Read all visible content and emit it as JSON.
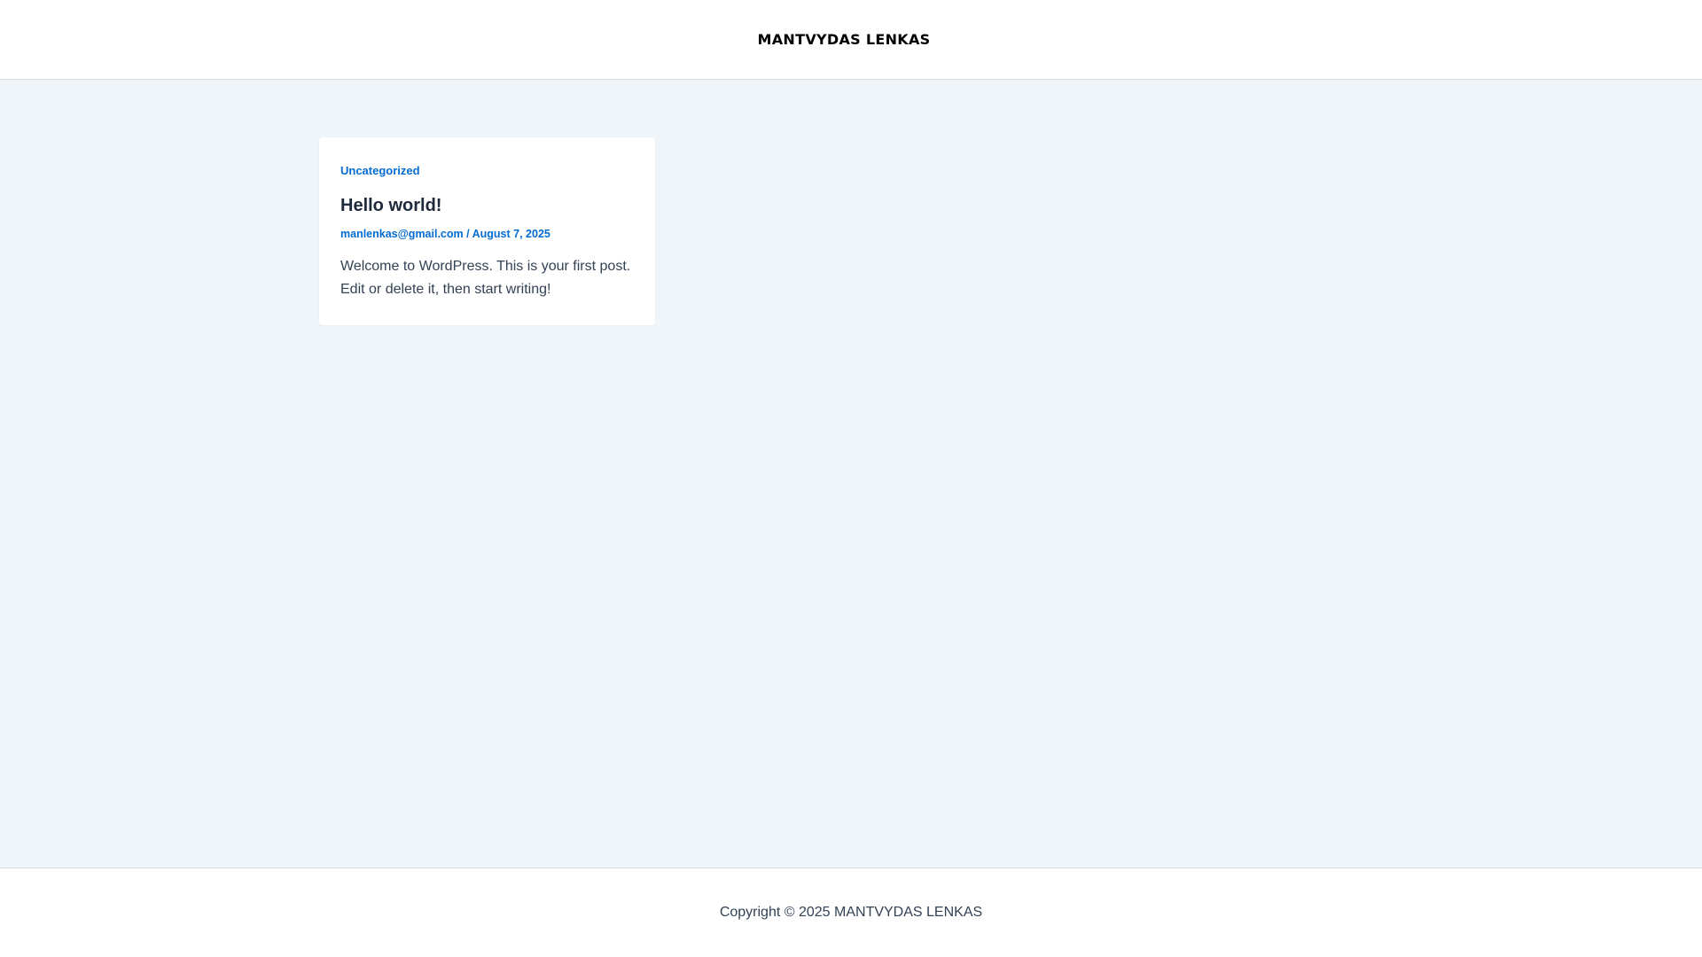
{
  "header": {
    "site_title": "MANTVYDAS LENKAS"
  },
  "post": {
    "category": "Uncategorized",
    "title": "Hello world!",
    "author": "manlenkas@gmail.com",
    "separator": "/",
    "date": "August 7, 2025",
    "excerpt": "Welcome to WordPress. This is your first post. Edit or delete it, then start writing!"
  },
  "footer": {
    "copyright": "Copyright © 2025 MANTVYDAS LENKAS"
  },
  "colors": {
    "accent": "#046bd2",
    "heading": "#1e293b",
    "text": "#334155",
    "background": "#f0f5fa"
  }
}
